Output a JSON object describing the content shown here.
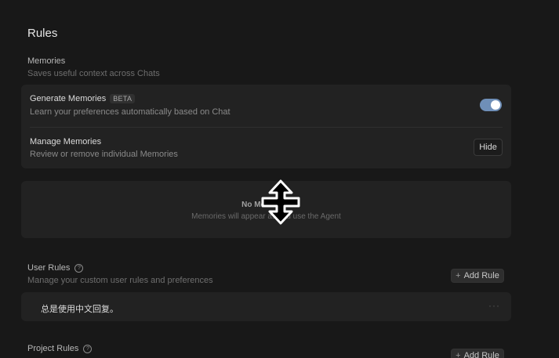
{
  "page": {
    "title": "Rules"
  },
  "memories": {
    "title": "Memories",
    "subtitle": "Saves useful context across Chats",
    "generate": {
      "title": "Generate Memories",
      "badge": "BETA",
      "description": "Learn your preferences automatically based on Chat",
      "enabled": true
    },
    "manage": {
      "title": "Manage Memories",
      "description": "Review or remove individual Memories",
      "button_label": "Hide"
    },
    "empty_state": {
      "title": "No Memories",
      "subtitle": "Memories will appear as you use the Agent"
    }
  },
  "user_rules": {
    "title": "User Rules",
    "subtitle": "Manage your custom user rules and preferences",
    "add_label": "Add Rule",
    "rules": [
      {
        "text": "总是使用中文回复。"
      }
    ]
  },
  "project_rules": {
    "title": "Project Rules",
    "add_label": "Add Rule"
  },
  "colors": {
    "background": "#181818",
    "card": "#222222",
    "toggle_on": "#6f8fb8"
  },
  "icons": {
    "help": "help-circle-icon",
    "plus": "plus-icon",
    "more": "more-horizontal-icon",
    "cursor": "resize-vertical-cursor-icon"
  }
}
